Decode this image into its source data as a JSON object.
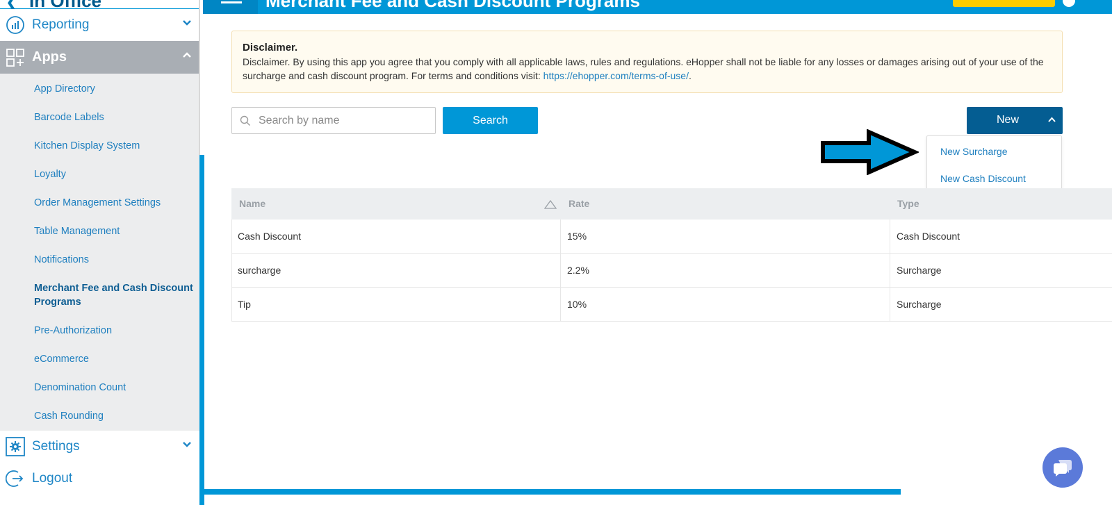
{
  "sidebar": {
    "top_title": "In Office",
    "reporting_label": "Reporting",
    "apps_label": "Apps",
    "settings_label": "Settings",
    "logout_label": "Logout",
    "apps_items": [
      {
        "label": "App Directory"
      },
      {
        "label": "Barcode Labels"
      },
      {
        "label": "Kitchen Display System"
      },
      {
        "label": "Loyalty"
      },
      {
        "label": "Order Management Settings"
      },
      {
        "label": "Table Management"
      },
      {
        "label": "Notifications"
      },
      {
        "label": "Merchant Fee and Cash Discount Programs",
        "active": true
      },
      {
        "label": "Pre-Authorization"
      },
      {
        "label": "eCommerce"
      },
      {
        "label": "Denomination Count"
      },
      {
        "label": "Cash Rounding"
      }
    ]
  },
  "header": {
    "page_title": "Merchant Fee and Cash Discount Programs"
  },
  "disclaimer": {
    "heading": "Disclaimer.",
    "text": "Disclaimer. By using this app you agree that you comply with all applicable laws, rules and regulations. eHopper shall not be liable for any losses or damages arising out of your use of the surcharge and cash discount program. For terms and conditions visit: ",
    "link": "https://ehopper.com/terms-of-use/",
    "suffix": "."
  },
  "search": {
    "placeholder": "Search by name",
    "button_label": "Search"
  },
  "new_menu": {
    "button_label": "New",
    "items": [
      {
        "label": "New Surcharge"
      },
      {
        "label": "New Cash Discount"
      }
    ]
  },
  "table": {
    "columns": [
      "Name",
      "Rate",
      "Type"
    ],
    "rows": [
      {
        "name": "Cash Discount",
        "rate": "15%",
        "type": "Cash Discount"
      },
      {
        "name": "surcharge",
        "rate": "2.2%",
        "type": "Surcharge"
      },
      {
        "name": "Tip",
        "rate": "10%",
        "type": "Surcharge"
      }
    ]
  },
  "colors": {
    "primary": "#0097d7",
    "primary_dark": "#045d92",
    "link": "#1e7fbf",
    "apps_header_bg": "#a9aeb4",
    "arrow_fill": "#0097d7"
  }
}
